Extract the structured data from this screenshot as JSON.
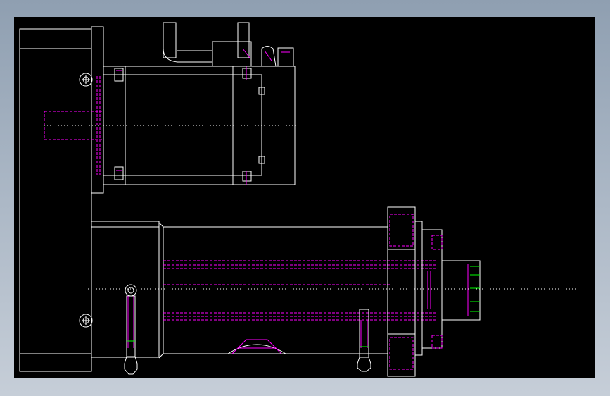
{
  "viewport": {
    "background": "#000000",
    "line_colors": {
      "outline": "#ffffff",
      "hidden": "#ff00ff",
      "thread": "#00ff00"
    }
  }
}
